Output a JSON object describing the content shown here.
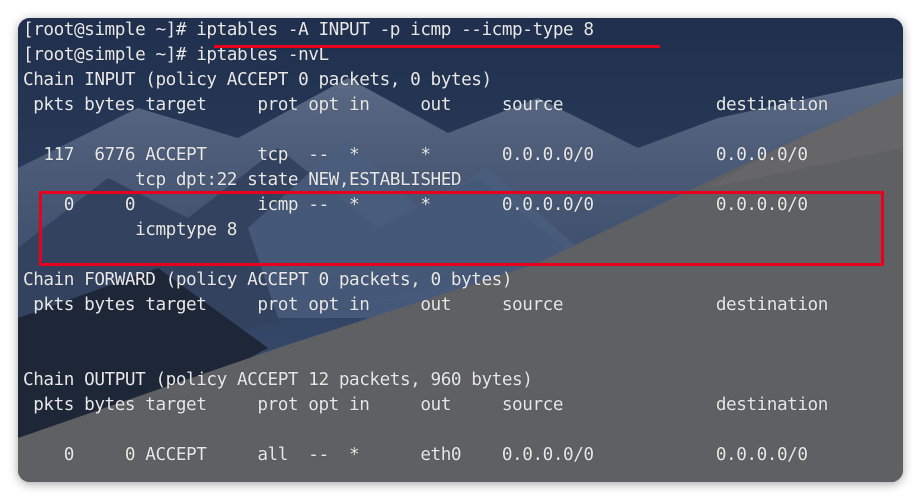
{
  "terminal": {
    "lines": [
      "[root@simple ~]# iptables -A INPUT -p icmp --icmp-type 8",
      "[root@simple ~]# iptables -nvL",
      "Chain INPUT (policy ACCEPT 0 packets, 0 bytes)",
      " pkts bytes target     prot opt in     out     source               destination",
      "",
      "  117  6776 ACCEPT     tcp  --  *      *       0.0.0.0/0            0.0.0.0/0",
      "           tcp dpt:22 state NEW,ESTABLISHED",
      "    0     0            icmp --  *      *       0.0.0.0/0            0.0.0.0/0",
      "           icmptype 8",
      "",
      "Chain FORWARD (policy ACCEPT 0 packets, 0 bytes)",
      " pkts bytes target     prot opt in     out     source               destination",
      "",
      "",
      "Chain OUTPUT (policy ACCEPT 12 packets, 960 bytes)",
      " pkts bytes target     prot opt in     out     source               destination",
      "",
      "    0     0 ACCEPT     all  --  *      eth0    0.0.0.0/0            0.0.0.0/0"
    ]
  },
  "annotation_color": "#e8001c"
}
